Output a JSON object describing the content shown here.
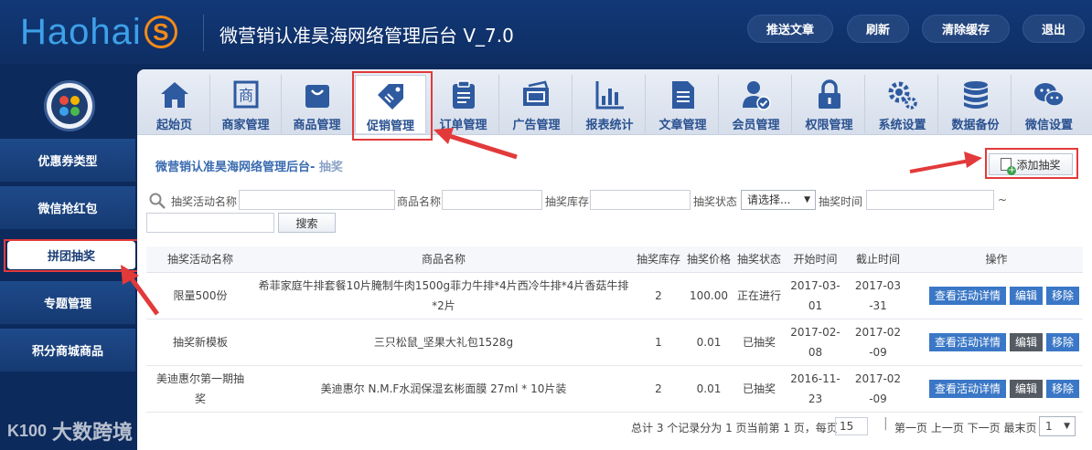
{
  "header": {
    "logo_text": "Haohai",
    "logo_mark": "S",
    "title": "微营销认准昊海网络管理后台 V_7.0",
    "buttons": [
      "推送文章",
      "刷新",
      "清除缓存",
      "退出"
    ]
  },
  "sidebar": {
    "items": [
      "优惠券类型",
      "微信抢红包",
      "拼团抽奖",
      "专题管理",
      "积分商城商品"
    ],
    "active_index": 2
  },
  "tabs": [
    {
      "label": "起始页",
      "icon": "home-icon"
    },
    {
      "label": "商家管理",
      "icon": "shop-icon"
    },
    {
      "label": "商品管理",
      "icon": "bag-icon"
    },
    {
      "label": "促销管理",
      "icon": "tag-icon"
    },
    {
      "label": "订单管理",
      "icon": "clipboard-icon"
    },
    {
      "label": "广告管理",
      "icon": "ad-icon"
    },
    {
      "label": "报表统计",
      "icon": "bar-chart-icon"
    },
    {
      "label": "文章管理",
      "icon": "document-icon"
    },
    {
      "label": "会员管理",
      "icon": "member-icon"
    },
    {
      "label": "权限管理",
      "icon": "lock-icon"
    },
    {
      "label": "系统设置",
      "icon": "gears-icon"
    },
    {
      "label": "数据备份",
      "icon": "database-icon"
    },
    {
      "label": "微信设置",
      "icon": "wechat-icon"
    }
  ],
  "active_tab_index": 3,
  "breadcrumb": {
    "main": "微营销认准昊海网络管理后台-",
    "sub": " 抽奖"
  },
  "add_button_label": "添加抽奖",
  "filters": {
    "name_label": "抽奖活动名称",
    "product_label": "商品名称",
    "stock_label": "抽奖库存",
    "status_label": "抽奖状态",
    "status_value": "请选择...",
    "time_label": "抽奖时间",
    "time_separator": "~",
    "search_label": "搜索"
  },
  "table": {
    "headers": [
      "抽奖活动名称",
      "商品名称",
      "抽奖库存",
      "抽奖价格",
      "抽奖状态",
      "开始时间",
      "截止时间",
      "操作"
    ],
    "rows": [
      {
        "name": "限量500份",
        "product": "希菲家庭牛排套餐10片腌制牛肉1500g菲力牛排*4片西冷牛排*4片香菇牛排*2片",
        "stock": "2",
        "price": "100.00",
        "status": "正在进行",
        "start": "2017-03-01",
        "end": "2017-03-31"
      },
      {
        "name": "抽奖新模板",
        "product": "三只松鼠_坚果大礼包1528g",
        "stock": "1",
        "price": "0.01",
        "status": "已抽奖",
        "start": "2017-02-08",
        "end": "2017-02-09"
      },
      {
        "name": "美迪惠尔第一期抽奖",
        "product": "美迪惠尔 N.M.F水润保湿玄彬面膜 27ml * 10片装",
        "stock": "2",
        "price": "0.01",
        "status": "已抽奖",
        "start": "2016-11-23",
        "end": "2017-02-09"
      }
    ],
    "actions": [
      "查看活动详情",
      "编辑",
      "移除"
    ]
  },
  "pager": {
    "summary": "总计 3 个记录分为 1 页当前第 1 页，每页",
    "per_page": "15",
    "nav": "第一页 上一页 下一页 最末页",
    "page_value": "1"
  },
  "watermark": {
    "text": "大数跨境",
    "mark": "K100"
  },
  "colors": {
    "header_bg": "#123876",
    "accent": "#3a77c6",
    "annotation_red": "#e23a3a",
    "logo_blue": "#3ea0e8",
    "logo_orange": "#f28a1a"
  }
}
